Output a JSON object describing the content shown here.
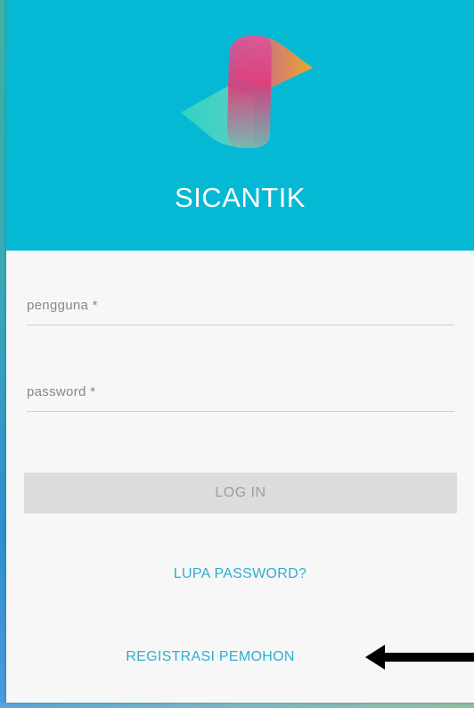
{
  "app": {
    "brand_name": "SICANTIK"
  },
  "form": {
    "username_label": "pengguna *",
    "password_label": "password *",
    "login_label": "LOG IN"
  },
  "links": {
    "forgot_password": "LUPA PASSWORD?",
    "register": "REGISTRASI PEMOHON"
  },
  "icons": {
    "logo": "sicantik-logo-icon",
    "pointer": "arrow-left-icon"
  },
  "colors": {
    "header": "#05b9d4",
    "link": "#2eaed0",
    "button_bg": "#dcdcdc",
    "button_text": "#9e9e9e",
    "card_bg": "#f7f7f7"
  }
}
